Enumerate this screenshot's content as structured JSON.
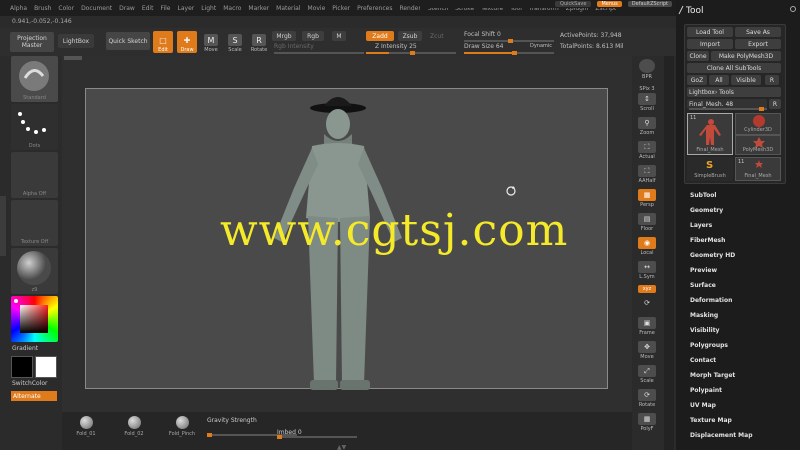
{
  "menubar": {
    "items": [
      "Alpha",
      "Brush",
      "Color",
      "Document",
      "Draw",
      "Edit",
      "File",
      "Layer",
      "Light",
      "Macro",
      "Marker",
      "Material",
      "Movie",
      "Picker",
      "Preferences",
      "Render",
      "Stencil",
      "Stroke",
      "Texture",
      "Tool",
      "Transform",
      "Zplugin",
      "Zscript"
    ],
    "quicksave": "QuickSave",
    "menus": "Menus",
    "default_script": "DefaultZScript"
  },
  "coords": "0.941,-0.052,-0.146",
  "toolbar": {
    "projection_master": "Projection Master",
    "lightbox": "LightBox",
    "quick_sketch": "Quick Sketch",
    "edit": "Edit",
    "draw": "Draw",
    "move": "Move",
    "scale": "Scale",
    "rotate": "Rotate",
    "mrgb": "Mrgb",
    "rgb": "Rgb",
    "m": "M",
    "rgb_intensity": "Rgb Intensity",
    "zadd": "Zadd",
    "zsub": "Zsub",
    "zcut": "Zcut",
    "z_intensity_label": "Z Intensity",
    "z_intensity_value": "25",
    "focal_shift_label": "Focal Shift",
    "focal_shift_value": "0",
    "draw_size_label": "Draw Size",
    "draw_size_value": "64",
    "dynamic": "Dynamic",
    "active_points_label": "ActivePoints:",
    "active_points_value": "37,948",
    "total_points_label": "TotalPoints:",
    "total_points_value": "8.613 Mil"
  },
  "leftshelf": {
    "standard": "Standard",
    "dots": "Dots",
    "alpha_off": "Alpha Off",
    "texture_off": "Texture Off",
    "material": "z9",
    "gradient": "Gradient",
    "switch_color": "SwitchColor",
    "alternate": "Alternate"
  },
  "watermark": "www.cgtsj.com",
  "bottombar": {
    "brushes": [
      "Fold_01",
      "Fold_02",
      "Fold_Pinch"
    ],
    "gravity_strength": "Gravity Strength",
    "imbed_label": "Imbed",
    "imbed_value": "0"
  },
  "rshelf": {
    "bpr": "BPR",
    "spix": "SPix",
    "spix_value": "3",
    "scroll": "Scroll",
    "zoom": "Zoom",
    "actual": "Actual",
    "aahalf": "AAHalf",
    "persp": "Persp",
    "floor": "Floor",
    "local": "Local",
    "lsym": "L.Sym",
    "xyz": "xyz",
    "frame": "Frame",
    "move": "Move",
    "scale": "Scale",
    "rotate": "Rotate",
    "polyf": "PolyF"
  },
  "tool": {
    "title": "Tool",
    "load_tool": "Load Tool",
    "save_as": "Save As",
    "import": "Import",
    "export": "Export",
    "clone": "Clone",
    "make_polymesh": "Make PolyMesh3D",
    "clone_all": "Clone All SubTools",
    "goz": "GoZ",
    "all": "All",
    "visible": "Visible",
    "r": "R",
    "lightbox_tools": "Lightbox› Tools",
    "current_tool": "Final_Mesh. 48",
    "thumbs": [
      {
        "num": "11",
        "label": "Final_Mesh"
      },
      {
        "num": "",
        "label": "Cylinder3D"
      },
      {
        "num": "",
        "label": "PolyMesh3D"
      },
      {
        "num": "",
        "label": "SimpleBrush"
      },
      {
        "num": "11",
        "label": "Final_Mesh"
      }
    ],
    "menus": [
      "SubTool",
      "Geometry",
      "Layers",
      "FiberMesh",
      "Geometry HD",
      "Preview",
      "Surface",
      "Deformation",
      "Masking",
      "Visibility",
      "Polygroups",
      "Contact",
      "Morph Target",
      "Polypaint",
      "UV Map",
      "Texture Map",
      "Displacement Map"
    ]
  },
  "colors": {
    "accent": "#e07b1c",
    "watermark": "#f4ea2a",
    "viewport_bg": "#4a4a4a",
    "figure": "#8a9690"
  }
}
